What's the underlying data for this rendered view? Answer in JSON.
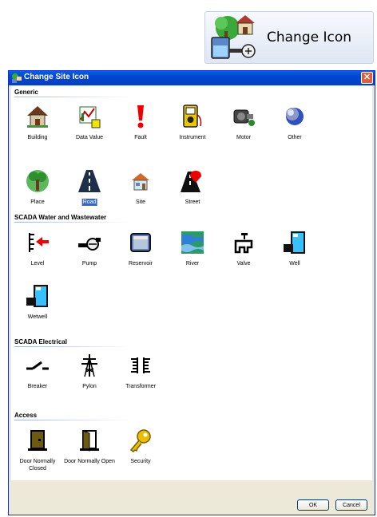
{
  "top_button": {
    "label": "Change Icon",
    "icon": "site-building-pump-icon"
  },
  "dialog": {
    "title": "Change Site Icon",
    "close_glyph": "✕",
    "sections": [
      {
        "title": "Generic",
        "items": [
          {
            "label": "Building",
            "icon": "house-icon"
          },
          {
            "label": "Data Value",
            "icon": "data-value-icon"
          },
          {
            "label": "Fault",
            "icon": "exclamation-icon"
          },
          {
            "label": "Instrument",
            "icon": "meter-icon"
          },
          {
            "label": "Motor",
            "icon": "motor-icon"
          },
          {
            "label": "Other",
            "icon": "sphere-icon"
          },
          {
            "label": "Place",
            "icon": "tree-icon"
          },
          {
            "label": "Road",
            "icon": "road-icon",
            "selected": true
          },
          {
            "label": "Site",
            "icon": "small-house-icon"
          },
          {
            "label": "Street",
            "icon": "street-icon"
          }
        ]
      },
      {
        "title": "SCADA Water and Wastewater",
        "items": [
          {
            "label": "Level",
            "icon": "level-icon"
          },
          {
            "label": "Pump",
            "icon": "pump-icon"
          },
          {
            "label": "Reservoir",
            "icon": "reservoir-icon"
          },
          {
            "label": "River",
            "icon": "river-icon"
          },
          {
            "label": "Valve",
            "icon": "valve-icon"
          },
          {
            "label": "Well",
            "icon": "well-icon"
          },
          {
            "label": "Wetwell",
            "icon": "wetwell-icon"
          }
        ]
      },
      {
        "title": "SCADA Electrical",
        "items": [
          {
            "label": "Breaker",
            "icon": "breaker-icon"
          },
          {
            "label": "Pylon",
            "icon": "pylon-icon"
          },
          {
            "label": "Transformer",
            "icon": "transformer-icon"
          }
        ]
      },
      {
        "title": "Access",
        "items": [
          {
            "label": "Door Normally Closed",
            "icon": "door-closed-icon"
          },
          {
            "label": "Door Normally Open",
            "icon": "door-open-icon"
          },
          {
            "label": "Security",
            "icon": "key-icon"
          }
        ]
      }
    ],
    "ok_label": "OK",
    "cancel_label": "Cancel"
  }
}
